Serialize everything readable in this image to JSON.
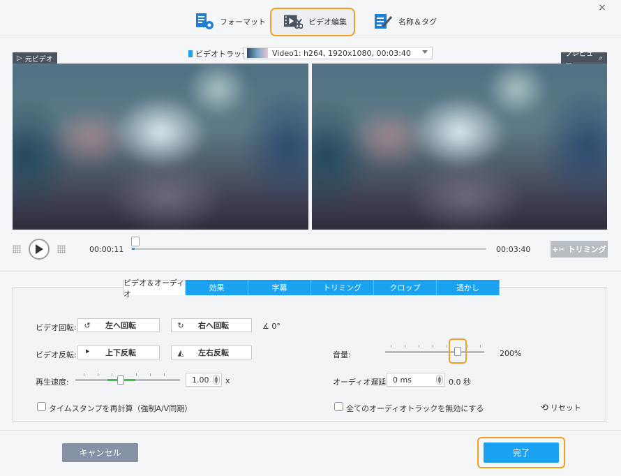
{
  "top_tabs": [
    {
      "label": "フォーマット",
      "icon": "format-settings-icon"
    },
    {
      "label": "ビデオ編集",
      "icon": "video-edit-icon"
    },
    {
      "label": "名称＆タグ",
      "icon": "name-tag-icon"
    }
  ],
  "close_symbol": "×",
  "video_track": {
    "label": "ビデオトラック:",
    "value": "Video1: h264, 1920x1080, 00:03:40"
  },
  "panels": {
    "original_label": "元ビデオ",
    "preview_label": "プレビュー"
  },
  "playback": {
    "current_time": "00:00:11",
    "total_time": "00:03:40",
    "trim_label": "トリミング"
  },
  "edit_tabs": [
    "ビデオ＆オーディオ",
    "効果",
    "字幕",
    "トリミング",
    "クロップ",
    "透かし"
  ],
  "video": {
    "rotate_label": "ビデオ回転:",
    "rotate_left": "左へ回転",
    "rotate_right": "右へ回転",
    "rotation_angle": "0°",
    "flip_label": "ビデオ反転:",
    "flip_vertical": "上下反転",
    "flip_horizontal": "左右反転",
    "speed_label": "再生速度:",
    "speed_value": "1.00",
    "speed_unit": "x",
    "timestamp_label": "タイムスタンプを再計算（強制A/V同期）"
  },
  "audio": {
    "volume_label": "音量:",
    "volume_value": "200%",
    "delay_label": "オーディオ遅延:",
    "delay_value": "0 ms",
    "delay_seconds": "0.0 秒",
    "disable_label": "全てのオーディオトラックを無効にする",
    "reset_label": "リセット"
  },
  "footer": {
    "cancel": "キャンセル",
    "done": "完了"
  },
  "colors": {
    "accent_blue": "#1aa1f0",
    "highlight_orange": "#f0a020",
    "cancel_gray": "#8591a4",
    "speed_green": "#3cc04a"
  }
}
